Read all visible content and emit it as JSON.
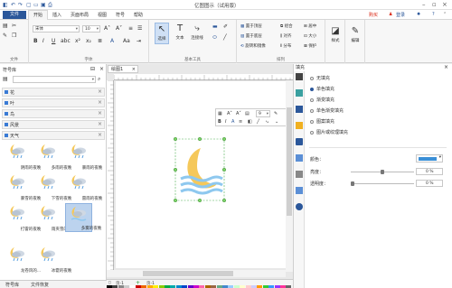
{
  "app": {
    "title": "亿图图示（试用版）",
    "tabs": [
      "文件",
      "开始",
      "插入",
      "页面布局",
      "视图",
      "符号",
      "帮助"
    ],
    "right_links": [
      "购买",
      "登录"
    ],
    "colors": {
      "accent": "#2b579a",
      "brand_red": "#d9230f"
    }
  },
  "ribbon": {
    "font_combo": "宋体",
    "size_combo": "10",
    "labels": {
      "file_group": "文件",
      "font_group": "字体",
      "basic_tools": "基本工具",
      "arrange": "排列"
    },
    "big_buttons": [
      "选择",
      "文本",
      "连接线"
    ],
    "arrange_items": [
      "置于顶层",
      "置于底层",
      "旋转和镜像",
      "组合",
      "对齐",
      "分布",
      "居中",
      "大小",
      "保护"
    ],
    "right_buttons": [
      "样式",
      "编辑"
    ]
  },
  "library": {
    "title": "符号库",
    "sections": [
      "花",
      "叶",
      "鸟",
      "风景",
      "天气"
    ],
    "symbols": [
      "阴雨的夜晚",
      "多雨的夜晚",
      "暴雨的夜晚",
      "暴雪的夜晚",
      "下雪的夜晚",
      "雷雨的夜晚",
      "打雷的夜晚",
      "雨夹雪的...",
      "多雾的夜晚",
      "龙卷风的...",
      "冰雹的夜晚"
    ]
  },
  "canvas": {
    "doc_tab": "绘图1",
    "page_label": "页-1",
    "page_label2": "页-1",
    "mini_font": "9"
  },
  "right_panel": {
    "header": "填充",
    "options": [
      "无填充",
      "单色填充",
      "渐变填充",
      "单色渐变填充",
      "图案填充",
      "图片或纹理填充"
    ],
    "selected_index": 1,
    "color_label": "颜色：",
    "color_value": "#3a8fd6",
    "brightness_label": "亮度：",
    "brightness_value": "0 %",
    "transparency_label": "透明度：",
    "transparency_value": "0 %"
  },
  "status_tabs": [
    "符号库",
    "文件恢复"
  ]
}
